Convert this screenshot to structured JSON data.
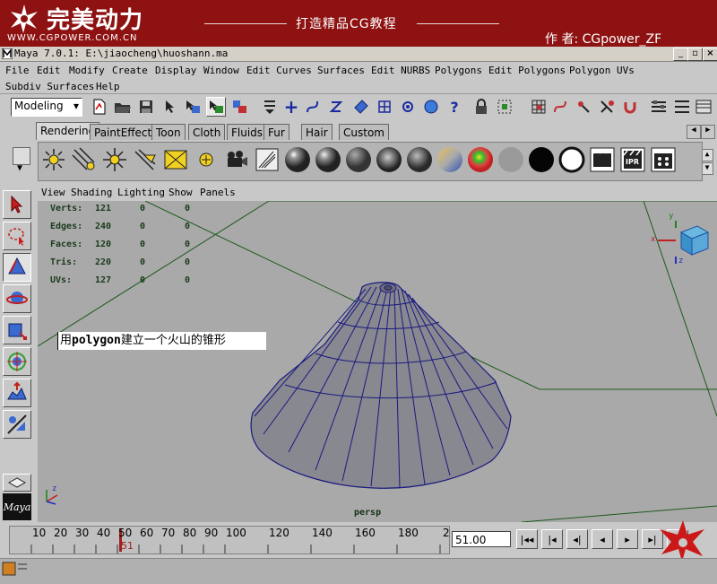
{
  "banner": {
    "logo_text": "完美动力",
    "logo_url": "WWW.CGPOWER.COM.CN",
    "title": "打造精品CG教程",
    "author": "作 者:  CGpower_ZF",
    "bg_color": "#8e1212"
  },
  "window": {
    "title": "Maya 7.0.1: E:\\jiaocheng\\huoshann.ma",
    "minimize": "_",
    "maximize": "▫",
    "close": "×"
  },
  "menus": {
    "row1": [
      "File",
      "Edit",
      "Modify",
      "Create",
      "Display",
      "Window",
      "Edit Curves",
      "Surfaces",
      "Edit NURBS",
      "Polygons",
      "Edit Polygons",
      "Polygon UVs"
    ],
    "row2": [
      "Subdiv Surfaces",
      "Help"
    ]
  },
  "toolbar": {
    "mode": "Modeling",
    "mode_caret": "▾"
  },
  "shelf": {
    "tabs": [
      "Rendering",
      "PaintEffects",
      "Toon",
      "Cloth",
      "Fluids",
      "Fur",
      "Hair",
      "Custom"
    ],
    "active_tab": "Rendering",
    "ipr_label": "IPR"
  },
  "panel_menu": [
    "View",
    "Shading",
    "Lighting",
    "Show",
    "Panels"
  ],
  "hud": {
    "rows": [
      {
        "label": "Verts:",
        "v1": "121",
        "v2": "0",
        "v3": "0"
      },
      {
        "label": "Edges:",
        "v1": "240",
        "v2": "0",
        "v3": "0"
      },
      {
        "label": "Faces:",
        "v1": "120",
        "v2": "0",
        "v3": "0"
      },
      {
        "label": "Tris:",
        "v1": "220",
        "v2": "0",
        "v3": "0"
      },
      {
        "label": "UVs:",
        "v1": "127",
        "v2": "0",
        "v3": "0"
      }
    ]
  },
  "note": {
    "pre": "用",
    "bold": "polygon",
    "post": "建立一个火山的锥形"
  },
  "camera_label": "persp",
  "axis_labels": {
    "z": "z",
    "y": "y",
    "x": "x"
  },
  "maya_logo": "Maya",
  "timeline": {
    "ticks": [
      "10",
      "20",
      "30",
      "40",
      "50",
      "60",
      "70",
      "80",
      "90",
      "100",
      "120",
      "140",
      "160",
      "180",
      "2"
    ],
    "current_marker": "51",
    "current_frame": "51.00"
  },
  "playback": [
    "|◂◂",
    "|◂",
    "◂|",
    "◂",
    "▸",
    "▸|",
    "▸▸|"
  ]
}
